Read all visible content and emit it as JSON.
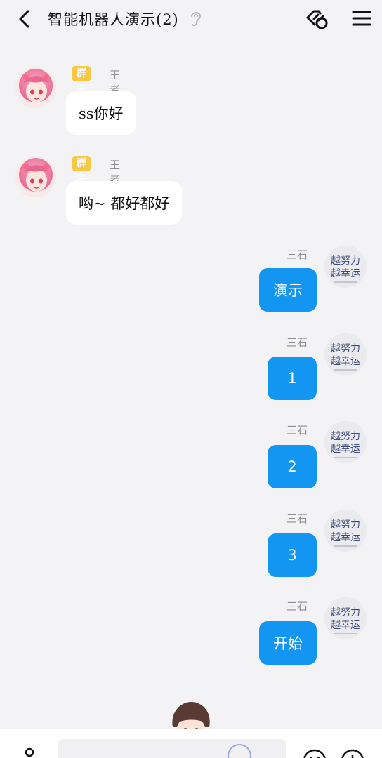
{
  "header": {
    "title": "智能机器人演示(2)",
    "icons": [
      "back-arrow-icon",
      "ear-icon",
      "link-icon",
      "menu-icon"
    ]
  },
  "messages": [
    {
      "side": "left",
      "badge": "群主",
      "sender": "王者辅助",
      "text": "ss你好"
    },
    {
      "side": "left",
      "badge": "群主",
      "sender": "王者辅助",
      "text": "哟~ 都好都好"
    },
    {
      "side": "right",
      "sender": "三石",
      "text": "演示"
    },
    {
      "side": "right",
      "sender": "三石",
      "text": "1"
    },
    {
      "side": "right",
      "sender": "三石",
      "text": "2"
    },
    {
      "side": "right",
      "sender": "三石",
      "text": "3"
    },
    {
      "side": "right",
      "sender": "三石",
      "text": "开始"
    }
  ],
  "avatar_right_text": {
    "line1": "越努力",
    "line2": "越幸运"
  },
  "input": {
    "placeholder": ""
  },
  "colors": {
    "background": "#f3f2f4",
    "bubble_right": "#1296f2",
    "bubble_left": "#ffffff",
    "badge": "#f7c843",
    "sender": "#8e8e93"
  }
}
